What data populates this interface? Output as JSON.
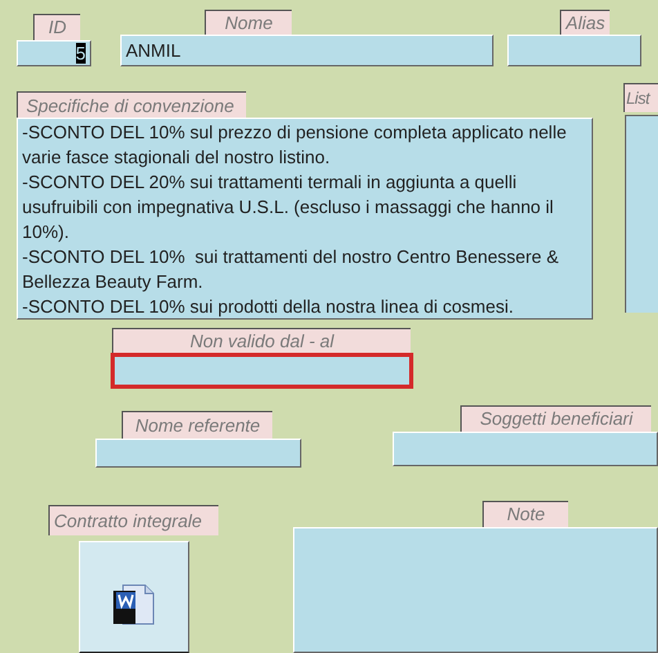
{
  "fields": [
    {
      "kind": "text",
      "label": "ID",
      "value": "5",
      "value_selected": true
    },
    {
      "kind": "text",
      "label": "Nome",
      "value": "ANMIL"
    },
    {
      "kind": "text",
      "label": "Alias"
    },
    {
      "kind": "memo",
      "label": "Specifiche di convenzione",
      "lines": [
        "-SCONTO DEL 10% sul prezzo di pensione completa applicato nelle varie fasce stagionali del nostro listino.",
        "-SCONTO DEL 20% sui trattamenti termali in aggiunta a quelli usufruibili con impegnativa U.S.L. (escluso i massaggi che hanno il 10%).",
        "-SCONTO DEL 10%  sui trattamenti del nostro Centro Benessere & Bellezza Beauty Farm.",
        "-SCONTO DEL 10% sui prodotti della nostra linea di cosmesi."
      ]
    },
    {
      "kind": "list",
      "label": "List"
    },
    {
      "kind": "text",
      "label": "Non valido dal - al",
      "focused": true
    },
    {
      "kind": "text",
      "label": "Nome referente"
    },
    {
      "kind": "text",
      "label": "Soggetti beneficiari"
    },
    {
      "kind": "attachment",
      "label": "Contratto integrale"
    },
    {
      "kind": "memo",
      "label": "Note"
    }
  ]
}
